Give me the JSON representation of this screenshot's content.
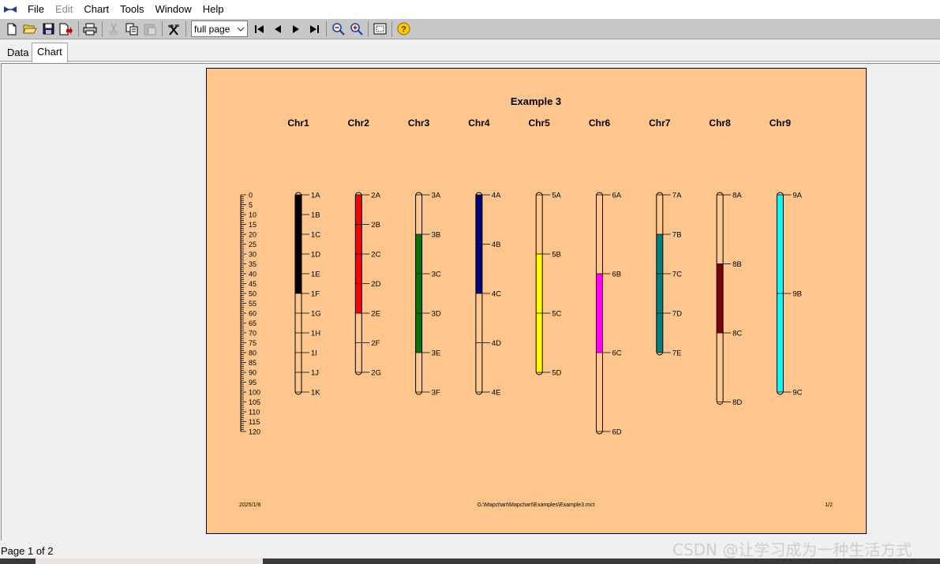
{
  "menu": {
    "items": [
      "File",
      "Edit",
      "Chart",
      "Tools",
      "Window",
      "Help"
    ],
    "disabled": [
      "Edit"
    ]
  },
  "toolbar": {
    "zoom_select_value": "full page"
  },
  "tabs": [
    "Data",
    "Chart"
  ],
  "active_tab": "Chart",
  "chart": {
    "title": "Example 3",
    "footer_left": "2025/1/8",
    "footer_center": "G:\\Mapchart\\Mapchart\\Examples\\Example3.mct",
    "footer_right": "1/2"
  },
  "chart_data": {
    "type": "chromosome-map",
    "title": "Example 3",
    "scale": {
      "min": 0,
      "max": 120,
      "major_step": 5,
      "labels": [
        "0",
        "5",
        "10",
        "15",
        "20",
        "25",
        "30",
        "35",
        "40",
        "45",
        "50",
        "55",
        "60",
        "65",
        "70",
        "75",
        "80",
        "85",
        "90",
        "95",
        "100",
        "105",
        "110",
        "115",
        "120"
      ]
    },
    "chromosomes": [
      {
        "name": "Chr1",
        "length": 100,
        "color": "#000000",
        "highlight": [
          0,
          50
        ],
        "markers": [
          {
            "label": "1A",
            "pos": 0
          },
          {
            "label": "1B",
            "pos": 10
          },
          {
            "label": "1C",
            "pos": 20
          },
          {
            "label": "1D",
            "pos": 30
          },
          {
            "label": "1E",
            "pos": 40
          },
          {
            "label": "1F",
            "pos": 50
          },
          {
            "label": "1G",
            "pos": 60
          },
          {
            "label": "1H",
            "pos": 70
          },
          {
            "label": "1I",
            "pos": 80
          },
          {
            "label": "1J",
            "pos": 90
          },
          {
            "label": "1K",
            "pos": 100
          }
        ]
      },
      {
        "name": "Chr2",
        "length": 90,
        "color": "#ff0000",
        "highlight": [
          0,
          60
        ],
        "markers": [
          {
            "label": "2A",
            "pos": 0
          },
          {
            "label": "2B",
            "pos": 15
          },
          {
            "label": "2C",
            "pos": 30
          },
          {
            "label": "2D",
            "pos": 45
          },
          {
            "label": "2E",
            "pos": 60
          },
          {
            "label": "2F",
            "pos": 75
          },
          {
            "label": "2G",
            "pos": 90
          }
        ]
      },
      {
        "name": "Chr3",
        "length": 100,
        "color": "#007800",
        "highlight": [
          20,
          80
        ],
        "markers": [
          {
            "label": "3A",
            "pos": 0
          },
          {
            "label": "3B",
            "pos": 20
          },
          {
            "label": "3C",
            "pos": 40
          },
          {
            "label": "3D",
            "pos": 60
          },
          {
            "label": "3E",
            "pos": 80
          },
          {
            "label": "3F",
            "pos": 100
          }
        ]
      },
      {
        "name": "Chr4",
        "length": 100,
        "color": "#000080",
        "highlight": [
          0,
          50
        ],
        "markers": [
          {
            "label": "4A",
            "pos": 0
          },
          {
            "label": "4B",
            "pos": 25
          },
          {
            "label": "4C",
            "pos": 50
          },
          {
            "label": "4D",
            "pos": 75
          },
          {
            "label": "4E",
            "pos": 100
          }
        ]
      },
      {
        "name": "Chr5",
        "length": 90,
        "color": "#ffff00",
        "highlight": [
          30,
          90
        ],
        "markers": [
          {
            "label": "5A",
            "pos": 0
          },
          {
            "label": "5B",
            "pos": 30
          },
          {
            "label": "5C",
            "pos": 60
          },
          {
            "label": "5D",
            "pos": 90
          }
        ]
      },
      {
        "name": "Chr6",
        "length": 120,
        "color": "#ff00ff",
        "highlight": [
          40,
          80
        ],
        "markers": [
          {
            "label": "6A",
            "pos": 0
          },
          {
            "label": "6B",
            "pos": 40
          },
          {
            "label": "6C",
            "pos": 80
          },
          {
            "label": "6D",
            "pos": 120
          }
        ]
      },
      {
        "name": "Chr7",
        "length": 80,
        "color": "#008080",
        "highlight": [
          20,
          80
        ],
        "markers": [
          {
            "label": "7A",
            "pos": 0
          },
          {
            "label": "7B",
            "pos": 20
          },
          {
            "label": "7C",
            "pos": 40
          },
          {
            "label": "7D",
            "pos": 60
          },
          {
            "label": "7E",
            "pos": 80
          }
        ]
      },
      {
        "name": "Chr8",
        "length": 105,
        "color": "#800000",
        "highlight": [
          35,
          70
        ],
        "markers": [
          {
            "label": "8A",
            "pos": 0
          },
          {
            "label": "8B",
            "pos": 35
          },
          {
            "label": "8C",
            "pos": 70
          },
          {
            "label": "8D",
            "pos": 105
          }
        ]
      },
      {
        "name": "Chr9",
        "length": 100,
        "color": "#00ffff",
        "highlight": [
          0,
          100
        ],
        "markers": [
          {
            "label": "9A",
            "pos": 0
          },
          {
            "label": "9B",
            "pos": 50
          },
          {
            "label": "9C",
            "pos": 100
          }
        ]
      }
    ]
  },
  "status": {
    "page_text": "Page 1 of 2"
  },
  "watermark": "CSDN @让学习成为一种生活方式",
  "icons": [
    "app-icon",
    "new-file-icon",
    "open-folder-icon",
    "save-icon",
    "export-icon",
    "print-icon",
    "cut-icon",
    "copy-icon",
    "paste-icon",
    "tools-icon",
    "first-page-icon",
    "previous-page-icon",
    "next-page-icon",
    "last-page-icon",
    "zoom-out-icon",
    "zoom-in-icon",
    "fit-page-icon",
    "help-icon"
  ]
}
